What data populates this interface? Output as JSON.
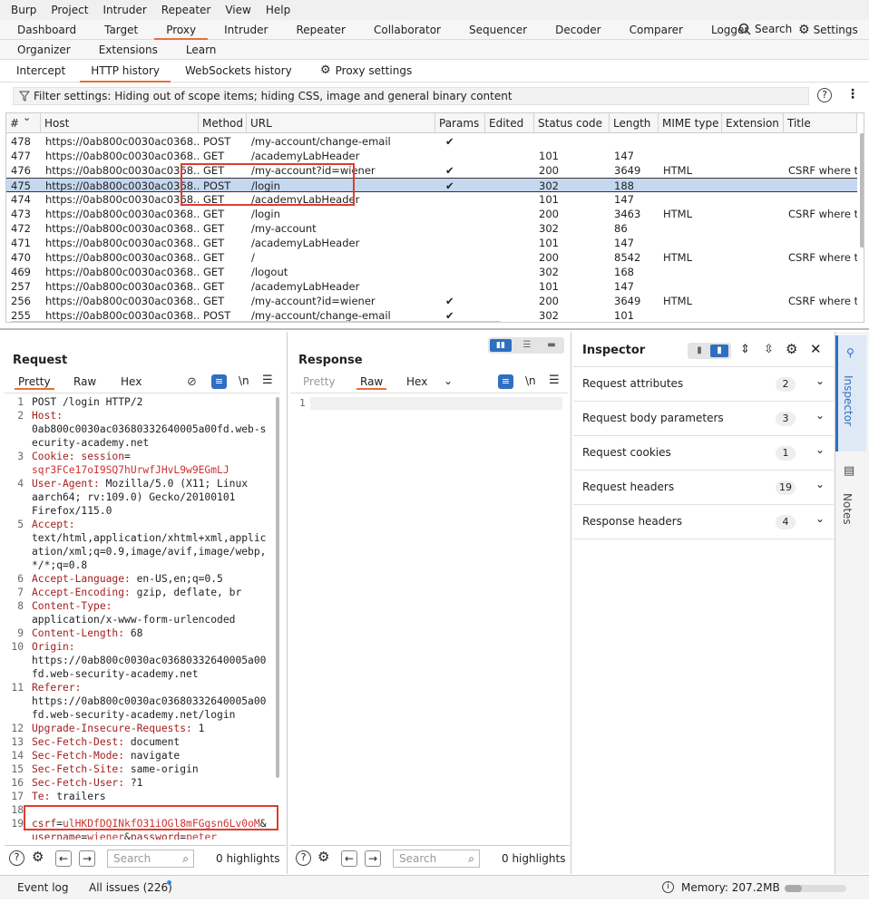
{
  "menu": [
    "Burp",
    "Project",
    "Intruder",
    "Repeater",
    "View",
    "Help"
  ],
  "tabs_row1": [
    "Dashboard",
    "Target",
    "Proxy",
    "Intruder",
    "Repeater",
    "Collaborator",
    "Sequencer",
    "Decoder",
    "Comparer",
    "Logger"
  ],
  "tabs_row1_active": "Proxy",
  "search_label": "Search",
  "settings_label": "Settings",
  "tabs_row2": [
    "Organizer",
    "Extensions",
    "Learn"
  ],
  "subtabs": [
    "Intercept",
    "HTTP history",
    "WebSockets history"
  ],
  "subtabs_active": "HTTP history",
  "proxy_settings": "Proxy settings",
  "filter_text": "Filter settings: Hiding out of scope items; hiding CSS, image and general binary content",
  "history": {
    "columns": [
      "#",
      "Host",
      "Method",
      "URL",
      "Params",
      "Edited",
      "Status code",
      "Length",
      "MIME type",
      "Extension",
      "Title"
    ],
    "rows": [
      {
        "num": "478",
        "host": "https://0ab800c0030ac0368...",
        "method": "POST",
        "url": "/my-account/change-email",
        "params": "✔",
        "status": "",
        "length": "",
        "mime": "",
        "title": ""
      },
      {
        "num": "477",
        "host": "https://0ab800c0030ac0368...",
        "method": "GET",
        "url": "/academyLabHeader",
        "params": "",
        "status": "101",
        "length": "147",
        "mime": "",
        "title": ""
      },
      {
        "num": "476",
        "host": "https://0ab800c0030ac0368...",
        "method": "GET",
        "url": "/my-account?id=wiener",
        "params": "✔",
        "status": "200",
        "length": "3649",
        "mime": "HTML",
        "title": "CSRF where to"
      },
      {
        "num": "475",
        "host": "https://0ab800c0030ac0368...",
        "method": "POST",
        "url": "/login",
        "params": "✔",
        "status": "302",
        "length": "188",
        "mime": "",
        "title": ""
      },
      {
        "num": "474",
        "host": "https://0ab800c0030ac0368...",
        "method": "GET",
        "url": "/academyLabHeader",
        "params": "",
        "status": "101",
        "length": "147",
        "mime": "",
        "title": ""
      },
      {
        "num": "473",
        "host": "https://0ab800c0030ac0368...",
        "method": "GET",
        "url": "/login",
        "params": "",
        "status": "200",
        "length": "3463",
        "mime": "HTML",
        "title": "CSRF where to"
      },
      {
        "num": "472",
        "host": "https://0ab800c0030ac0368...",
        "method": "GET",
        "url": "/my-account",
        "params": "",
        "status": "302",
        "length": "86",
        "mime": "",
        "title": ""
      },
      {
        "num": "471",
        "host": "https://0ab800c0030ac0368...",
        "method": "GET",
        "url": "/academyLabHeader",
        "params": "",
        "status": "101",
        "length": "147",
        "mime": "",
        "title": ""
      },
      {
        "num": "470",
        "host": "https://0ab800c0030ac0368...",
        "method": "GET",
        "url": "/",
        "params": "",
        "status": "200",
        "length": "8542",
        "mime": "HTML",
        "title": "CSRF where to"
      },
      {
        "num": "469",
        "host": "https://0ab800c0030ac0368...",
        "method": "GET",
        "url": "/logout",
        "params": "",
        "status": "302",
        "length": "168",
        "mime": "",
        "title": ""
      },
      {
        "num": "257",
        "host": "https://0ab800c0030ac0368...",
        "method": "GET",
        "url": "/academyLabHeader",
        "params": "",
        "status": "101",
        "length": "147",
        "mime": "",
        "title": ""
      },
      {
        "num": "256",
        "host": "https://0ab800c0030ac0368...",
        "method": "GET",
        "url": "/my-account?id=wiener",
        "params": "✔",
        "status": "200",
        "length": "3649",
        "mime": "HTML",
        "title": "CSRF where to"
      },
      {
        "num": "255",
        "host": "https://0ab800c0030ac0368...",
        "method": "POST",
        "url": "/my-account/change-email",
        "params": "✔",
        "status": "302",
        "length": "101",
        "mime": "",
        "title": ""
      }
    ],
    "selected": "475"
  },
  "request": {
    "title": "Request",
    "tabs": [
      "Pretty",
      "Raw",
      "Hex"
    ],
    "active_tab": "Pretty",
    "newline_label": "\\n",
    "lines": [
      {
        "n": "1",
        "parts": [
          [
            "hv",
            "POST /login HTTP/2"
          ]
        ]
      },
      {
        "n": "2",
        "parts": [
          [
            "hk",
            "Host:"
          ]
        ]
      },
      {
        "n": "",
        "parts": [
          [
            "hv",
            "0ab800c0030ac03680332640005a00fd.web-s"
          ]
        ]
      },
      {
        "n": "",
        "parts": [
          [
            "hv",
            "ecurity-academy.net"
          ]
        ]
      },
      {
        "n": "3",
        "parts": [
          [
            "hk",
            "Cookie: "
          ],
          [
            "hk",
            "session"
          ],
          [
            "hv",
            "="
          ]
        ]
      },
      {
        "n": "",
        "parts": [
          [
            "vr",
            "sqr3FCe17oI9SQ7hUrwfJHvL9w9EGmLJ"
          ]
        ]
      },
      {
        "n": "4",
        "parts": [
          [
            "hk",
            "User-Agent: "
          ],
          [
            "hv",
            "Mozilla/5.0 (X11; Linux"
          ]
        ]
      },
      {
        "n": "",
        "parts": [
          [
            "hv",
            "aarch64; rv:109.0) Gecko/20100101"
          ]
        ]
      },
      {
        "n": "",
        "parts": [
          [
            "hv",
            "Firefox/115.0"
          ]
        ]
      },
      {
        "n": "5",
        "parts": [
          [
            "hk",
            "Accept:"
          ]
        ]
      },
      {
        "n": "",
        "parts": [
          [
            "hv",
            "text/html,application/xhtml+xml,applic"
          ]
        ]
      },
      {
        "n": "",
        "parts": [
          [
            "hv",
            "ation/xml;q=0.9,image/avif,image/webp,"
          ]
        ]
      },
      {
        "n": "",
        "parts": [
          [
            "hv",
            "*/*;q=0.8"
          ]
        ]
      },
      {
        "n": "6",
        "parts": [
          [
            "hk",
            "Accept-Language: "
          ],
          [
            "hv",
            "en-US,en;q=0.5"
          ]
        ]
      },
      {
        "n": "7",
        "parts": [
          [
            "hk",
            "Accept-Encoding: "
          ],
          [
            "hv",
            "gzip, deflate, br"
          ]
        ]
      },
      {
        "n": "8",
        "parts": [
          [
            "hk",
            "Content-Type:"
          ]
        ]
      },
      {
        "n": "",
        "parts": [
          [
            "hv",
            "application/x-www-form-urlencoded"
          ]
        ]
      },
      {
        "n": "9",
        "parts": [
          [
            "hk",
            "Content-Length: "
          ],
          [
            "hv",
            "68"
          ]
        ]
      },
      {
        "n": "10",
        "parts": [
          [
            "hk",
            "Origin:"
          ]
        ]
      },
      {
        "n": "",
        "parts": [
          [
            "hv",
            "https://0ab800c0030ac03680332640005a00"
          ]
        ]
      },
      {
        "n": "",
        "parts": [
          [
            "hv",
            "fd.web-security-academy.net"
          ]
        ]
      },
      {
        "n": "11",
        "parts": [
          [
            "hk",
            "Referer:"
          ]
        ]
      },
      {
        "n": "",
        "parts": [
          [
            "hv",
            "https://0ab800c0030ac03680332640005a00"
          ]
        ]
      },
      {
        "n": "",
        "parts": [
          [
            "hv",
            "fd.web-security-academy.net/login"
          ]
        ]
      },
      {
        "n": "12",
        "parts": [
          [
            "hk",
            "Upgrade-Insecure-Requests: "
          ],
          [
            "hv",
            "1"
          ]
        ]
      },
      {
        "n": "13",
        "parts": [
          [
            "hk",
            "Sec-Fetch-Dest: "
          ],
          [
            "hv",
            "document"
          ]
        ]
      },
      {
        "n": "14",
        "parts": [
          [
            "hk",
            "Sec-Fetch-Mode: "
          ],
          [
            "hv",
            "navigate"
          ]
        ]
      },
      {
        "n": "15",
        "parts": [
          [
            "hk",
            "Sec-Fetch-Site: "
          ],
          [
            "hv",
            "same-origin"
          ]
        ]
      },
      {
        "n": "16",
        "parts": [
          [
            "hk",
            "Sec-Fetch-User: "
          ],
          [
            "hv",
            "?1"
          ]
        ]
      },
      {
        "n": "17",
        "parts": [
          [
            "hk",
            "Te: "
          ],
          [
            "hv",
            "trailers"
          ]
        ]
      },
      {
        "n": "18",
        "parts": []
      },
      {
        "n": "19",
        "parts": [
          [
            "hk",
            "csrf"
          ],
          [
            "hv",
            "="
          ],
          [
            "vr",
            "ulHKDfDQINkfO31iOGl8mFGgsn6Lv0oM"
          ],
          [
            "hv",
            "&"
          ]
        ]
      },
      {
        "n": "",
        "parts": [
          [
            "hk",
            "username"
          ],
          [
            "hv",
            "="
          ],
          [
            "vr",
            "wiener"
          ],
          [
            "hv",
            "&"
          ],
          [
            "hk",
            "password"
          ],
          [
            "hv",
            "="
          ],
          [
            "vr",
            "peter"
          ]
        ]
      }
    ],
    "search_placeholder": "Search",
    "highlights": "0 highlights"
  },
  "response": {
    "title": "Response",
    "tabs": [
      "Pretty",
      "Raw",
      "Hex"
    ],
    "active_tab": "Raw",
    "newline_label": "\\n",
    "search_placeholder": "Search",
    "highlights": "0 highlights"
  },
  "inspector": {
    "title": "Inspector",
    "rows": [
      {
        "label": "Request attributes",
        "count": "2"
      },
      {
        "label": "Request body parameters",
        "count": "3"
      },
      {
        "label": "Request cookies",
        "count": "1"
      },
      {
        "label": "Request headers",
        "count": "19"
      },
      {
        "label": "Response headers",
        "count": "4"
      }
    ],
    "side_tabs": [
      "Inspector",
      "Notes"
    ]
  },
  "status": {
    "event_log": "Event log",
    "issues": "All issues (226)",
    "memory": "Memory: 207.2MB",
    "memory_fraction": 0.28
  },
  "colors": {
    "accent": "#e8703a",
    "selection": "#c6d8f0",
    "highlight_box": "#e03c2e",
    "key": "#a3201f"
  }
}
